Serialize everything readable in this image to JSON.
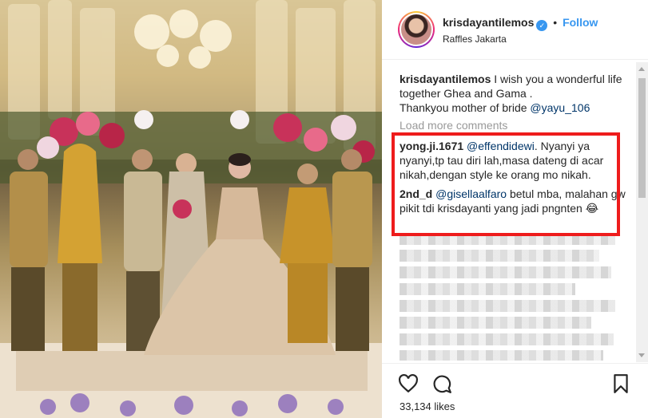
{
  "post": {
    "username": "krisdayantilemos",
    "follow_label": "Follow",
    "separator": "•",
    "verified_mark": "✓",
    "location": "Raffles Jakarta"
  },
  "caption": {
    "username": "krisdayantilemos",
    "text": "I wish you a wonderful life together Ghea and Gama .",
    "thanks": "Thankyou mother of bride",
    "mention": "@yayu_106"
  },
  "load_more": "Load more comments",
  "comments": [
    {
      "username": "yong.ji.1671",
      "mention": "@effendidewi",
      "text": ". Nyanyi ya nyanyi,tp tau diri lah,masa dateng di acar nikah,dengan style ke orang mo nikah."
    },
    {
      "username": "2nd_d",
      "mention": "@gisellaalfaro",
      "text": "betul mba, malahan gw pikit tdi krisdayanti yang jadi pngnten 😂"
    }
  ],
  "likes": "33,134 likes",
  "icons": {
    "verified": "verified-badge-icon",
    "like": "heart-icon",
    "comment": "comment-bubble-icon",
    "save": "bookmark-icon"
  },
  "colors": {
    "link": "#3897f0",
    "mention": "#003569",
    "highlight_border": "#ee1c1c",
    "text": "#262626",
    "muted": "#999999"
  }
}
